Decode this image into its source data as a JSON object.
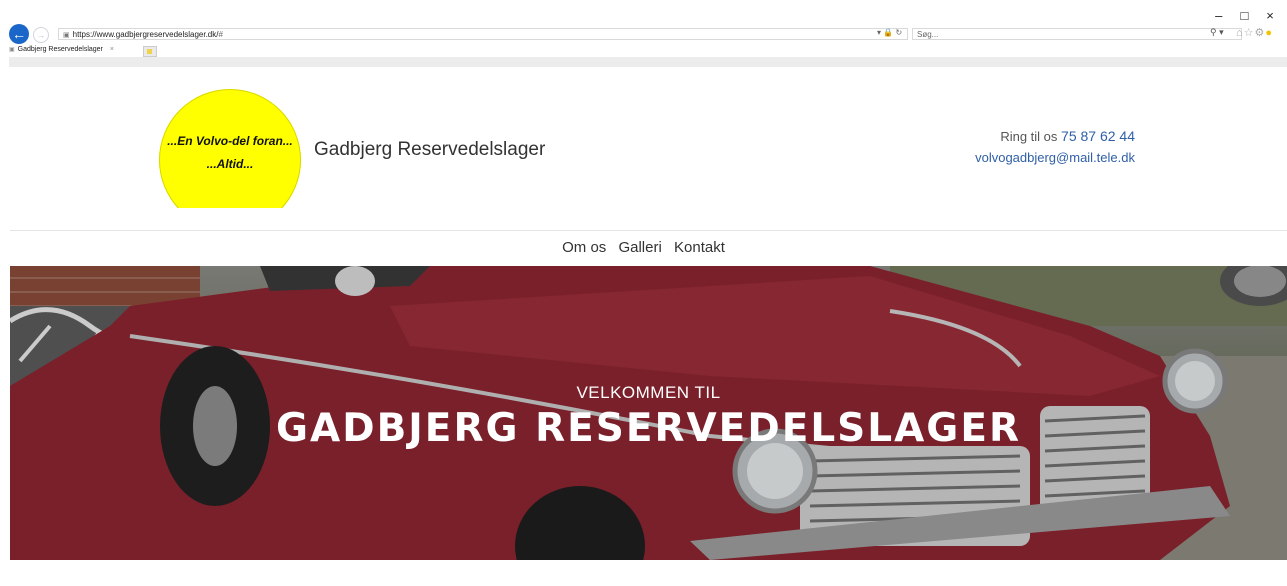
{
  "browser": {
    "url_host": "https://www.gadbjergreservedelslager.dk/",
    "url_path": "#",
    "search_placeholder": "Søg...",
    "tab_title": "Gadbjerg Reservedelslager",
    "window_controls": [
      "–",
      "□",
      "×"
    ]
  },
  "header": {
    "logo_line1": "...En Volvo-del foran...",
    "logo_line2": "...Altid...",
    "site_name": "Gadbjerg Reservedelslager",
    "phone_prefix": "Ring til os",
    "phone_number": "75 87 62 44",
    "email": "volvogadbjerg@mail.tele.dk"
  },
  "nav": {
    "items": [
      "Om os",
      "Galleri",
      "Kontakt"
    ]
  },
  "hero": {
    "subtitle": "VELKOMMEN TIL",
    "title": "GADBJERG RESERVEDELSLAGER"
  },
  "icons": {
    "back": "back-arrow-icon",
    "forward": "forward-arrow-icon",
    "lock": "lock-icon",
    "refresh": "refresh-icon",
    "search": "search-icon",
    "home": "home-icon",
    "favorites": "star-icon",
    "settings": "gear-icon",
    "feedback": "smiley-icon"
  },
  "colors": {
    "accent_link": "#2f5fa7",
    "logo_yellow": "#ffff00",
    "car_red": "#8b2530"
  }
}
